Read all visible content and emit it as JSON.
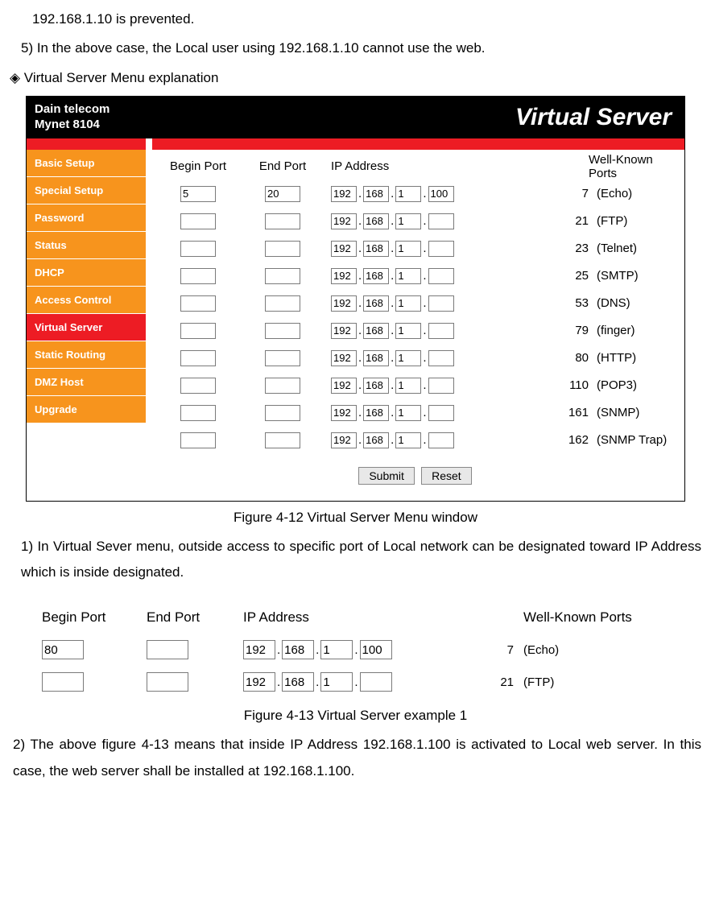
{
  "doc": {
    "line1": "192.168.1.10 is prevented.",
    "line2": "5) In the above case, the Local user using 192.168.1.10 cannot use the web.",
    "line3": "◈ Virtual Server Menu explanation",
    "caption1": "Figure 4-12 Virtual Server Menu window",
    "para1": "1) In Virtual Sever menu, outside access to specific port of Local network can be designated toward IP Address which is inside designated.",
    "caption2": "Figure 4-13 Virtual Server example 1",
    "para2": "2) The above figure 4-13 means that inside IP Address 192.168.1.100 is activated to Local web server.   In this case, the web server shall be installed at 192.168.1.100."
  },
  "router": {
    "brand1": "Dain telecom",
    "brand2": "Mynet 8104",
    "title": "Virtual Server",
    "nav": [
      "Basic Setup",
      "Special Setup",
      "Password",
      "Status",
      "DHCP",
      "Access Control",
      "Virtual Server",
      "Static Routing",
      "DMZ Host",
      "Upgrade"
    ],
    "nav_active_index": 6,
    "headers": {
      "begin": "Begin Port",
      "end": "End Port",
      "ip": "IP Address",
      "wkp": "Well-Known Ports"
    },
    "rows": [
      {
        "begin": "5",
        "end": "20",
        "ip": [
          "192",
          "168",
          "1",
          "100"
        ],
        "wkp_num": "7",
        "wkp_label": "(Echo)"
      },
      {
        "begin": "",
        "end": "",
        "ip": [
          "192",
          "168",
          "1",
          ""
        ],
        "wkp_num": "21",
        "wkp_label": "(FTP)"
      },
      {
        "begin": "",
        "end": "",
        "ip": [
          "192",
          "168",
          "1",
          ""
        ],
        "wkp_num": "23",
        "wkp_label": "(Telnet)"
      },
      {
        "begin": "",
        "end": "",
        "ip": [
          "192",
          "168",
          "1",
          ""
        ],
        "wkp_num": "25",
        "wkp_label": "(SMTP)"
      },
      {
        "begin": "",
        "end": "",
        "ip": [
          "192",
          "168",
          "1",
          ""
        ],
        "wkp_num": "53",
        "wkp_label": "(DNS)"
      },
      {
        "begin": "",
        "end": "",
        "ip": [
          "192",
          "168",
          "1",
          ""
        ],
        "wkp_num": "79",
        "wkp_label": "(finger)"
      },
      {
        "begin": "",
        "end": "",
        "ip": [
          "192",
          "168",
          "1",
          ""
        ],
        "wkp_num": "80",
        "wkp_label": "(HTTP)"
      },
      {
        "begin": "",
        "end": "",
        "ip": [
          "192",
          "168",
          "1",
          ""
        ],
        "wkp_num": "110",
        "wkp_label": "(POP3)"
      },
      {
        "begin": "",
        "end": "",
        "ip": [
          "192",
          "168",
          "1",
          ""
        ],
        "wkp_num": "161",
        "wkp_label": "(SNMP)"
      },
      {
        "begin": "",
        "end": "",
        "ip": [
          "192",
          "168",
          "1",
          ""
        ],
        "wkp_num": "162",
        "wkp_label": "(SNMP Trap)"
      }
    ],
    "buttons": {
      "submit": "Submit",
      "reset": "Reset"
    }
  },
  "example": {
    "headers": {
      "begin": "Begin Port",
      "end": "End Port",
      "ip": "IP Address",
      "wkp": "Well-Known Ports"
    },
    "rows": [
      {
        "begin": "80",
        "end": "",
        "ip": [
          "192",
          "168",
          "1",
          "100"
        ],
        "wkp_num": "7",
        "wkp_label": "(Echo)"
      },
      {
        "begin": "",
        "end": "",
        "ip": [
          "192",
          "168",
          "1",
          ""
        ],
        "wkp_num": "21",
        "wkp_label": "(FTP)"
      }
    ]
  }
}
